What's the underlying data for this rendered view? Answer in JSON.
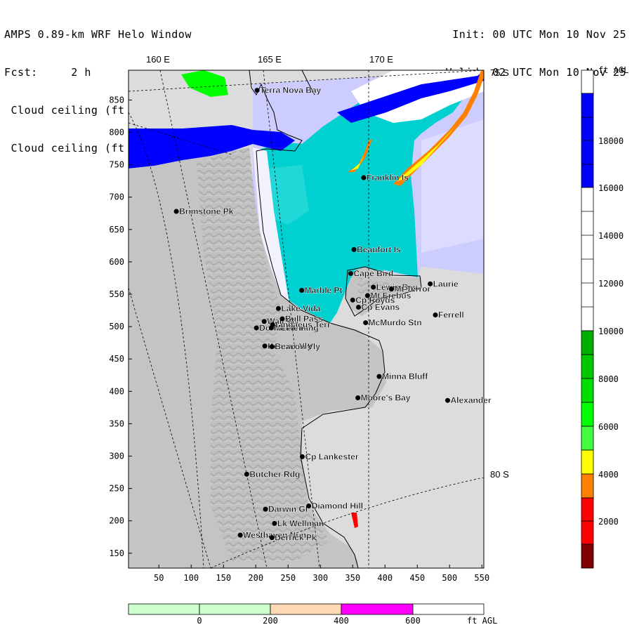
{
  "header": {
    "left": [
      "AMPS 0.89-km WRF Helo Window",
      "Fcst:     2 h",
      " Cloud ceiling (ft AGL)",
      " Cloud ceiling (ft AGL)"
    ],
    "right": [
      "Init: 00 UTC Mon 10 Nov 25",
      "Valid: 02 UTC Mon 10 Nov 25"
    ]
  },
  "map": {
    "lon_labels": [
      "160 E",
      "165 E",
      "170 E"
    ],
    "lat_labels": [
      "75 S",
      "80 S"
    ],
    "y_ticks": [
      850,
      800,
      750,
      700,
      650,
      600,
      550,
      500,
      450,
      400,
      350,
      300,
      250,
      200,
      150
    ],
    "x_ticks": [
      50,
      100,
      150,
      200,
      250,
      300,
      350,
      400,
      450,
      500,
      550
    ],
    "stations": [
      {
        "name": "Terra Nova Bay",
        "x": 202,
        "y": 865
      },
      {
        "name": "Franklin Is",
        "x": 367,
        "y": 730
      },
      {
        "name": "Brimstone Pk",
        "x": 77,
        "y": 678
      },
      {
        "name": "Beaufort Is",
        "x": 352,
        "y": 619
      },
      {
        "name": "Cape Bird",
        "x": 347,
        "y": 582
      },
      {
        "name": "Lewis Bay",
        "x": 382,
        "y": 561
      },
      {
        "name": "Laurie",
        "x": 470,
        "y": 566
      },
      {
        "name": "Mt Terror",
        "x": 410,
        "y": 558
      },
      {
        "name": "Marble Pt",
        "x": 271,
        "y": 556
      },
      {
        "name": "Cp Royds",
        "x": 350,
        "y": 541
      },
      {
        "name": "Mt Erebus",
        "x": 373,
        "y": 548
      },
      {
        "name": "Cp Evans",
        "x": 359,
        "y": 530
      },
      {
        "name": "Lake Vida",
        "x": 235,
        "y": 528
      },
      {
        "name": "Ferrell",
        "x": 478,
        "y": 518
      },
      {
        "name": "Wall Vly",
        "x": 213,
        "y": 508
      },
      {
        "name": "Bull Pass",
        "x": 241,
        "y": 512
      },
      {
        "name": "McMurdo Stn",
        "x": 370,
        "y": 506
      },
      {
        "name": "Don Juan Pd",
        "x": 201,
        "y": 498
      },
      {
        "name": "Mt Fleming",
        "x": 224,
        "y": 498
      },
      {
        "name": "Linnaeus Terr",
        "x": 226,
        "y": 503
      },
      {
        "name": "Kennar Vly",
        "x": 214,
        "y": 470
      },
      {
        "name": "Beacon Vly",
        "x": 225,
        "y": 469
      },
      {
        "name": "Minna Bluff",
        "x": 391,
        "y": 423
      },
      {
        "name": "Moore's Bay",
        "x": 358,
        "y": 390
      },
      {
        "name": "Alexander",
        "x": 497,
        "y": 386
      },
      {
        "name": "Cp Lankester",
        "x": 272,
        "y": 299
      },
      {
        "name": "Butcher Rdg",
        "x": 186,
        "y": 272
      },
      {
        "name": "Darwin Gl",
        "x": 215,
        "y": 218
      },
      {
        "name": "Diamond Hill",
        "x": 282,
        "y": 223
      },
      {
        "name": "Lk Wellman",
        "x": 229,
        "y": 196
      },
      {
        "name": "Westhaven Nun",
        "x": 176,
        "y": 178
      },
      {
        "name": "Derrick Pk",
        "x": 225,
        "y": 174
      }
    ]
  },
  "colorbar": {
    "unit": "ft AGL",
    "labels": [
      "18000",
      "16000",
      "14000",
      "12000",
      "10000",
      "8000",
      "6000",
      "4000",
      "2000"
    ],
    "colors": {
      "dark_red": "#800000",
      "red": "#ff0000",
      "orange": "#ff8000",
      "yellow": "#ffff00",
      "green": "#00ff00",
      "blue": "#0000ff",
      "white": "#ffffff"
    }
  },
  "hbar": {
    "labels": [
      "0",
      "200",
      "400",
      "600"
    ],
    "unit": "ft AGL",
    "colors": [
      "#ccffcc",
      "#ccffcc",
      "#ffd9b3",
      "#ff00ff",
      "#ffffff"
    ]
  }
}
